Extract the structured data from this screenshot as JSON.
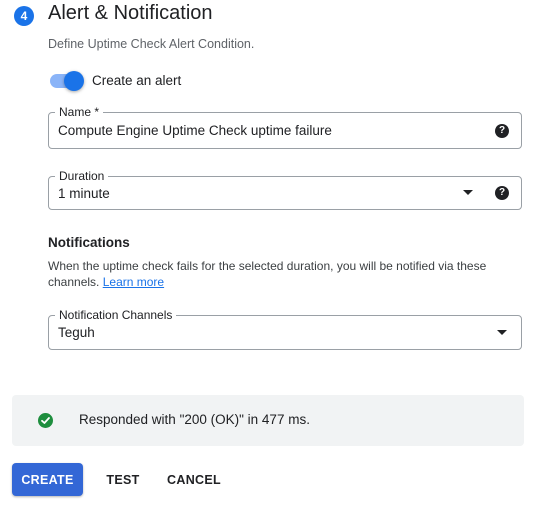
{
  "section": {
    "step_number": "4",
    "title": "Alert & Notification",
    "description": "Define Uptime Check Alert Condition."
  },
  "alert_toggle": {
    "label": "Create an alert",
    "enabled": true
  },
  "name_field": {
    "label": "Name *",
    "value": "Compute Engine Uptime Check uptime failure",
    "help_icon": "help-icon"
  },
  "duration_field": {
    "label": "Duration",
    "value": "1 minute",
    "help_icon": "help-icon"
  },
  "notifications": {
    "heading": "Notifications",
    "description": "When the uptime check fails for the selected duration, you will be notified via these channels.",
    "learn_more": "Learn more"
  },
  "channels_field": {
    "label": "Notification Channels",
    "value": "Teguh"
  },
  "status": {
    "icon": "check-circle-icon",
    "text": "Responded with \"200 (OK)\" in 477 ms."
  },
  "actions": {
    "create": "CREATE",
    "test": "TEST",
    "cancel": "CANCEL"
  },
  "colors": {
    "accent": "#1a73e8",
    "primary_button": "#3367d6",
    "success": "#1e8e3e",
    "status_bg": "#f1f3f4"
  }
}
